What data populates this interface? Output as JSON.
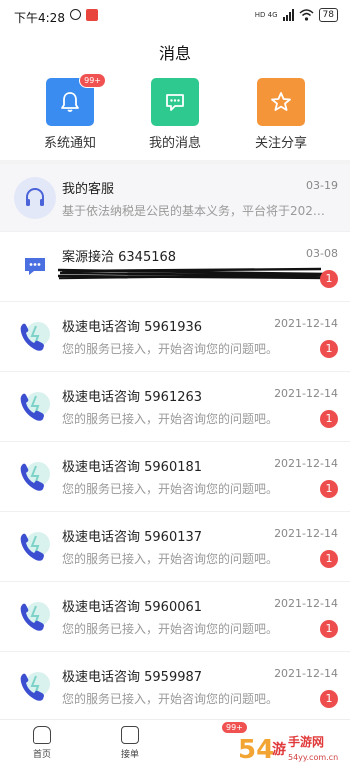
{
  "status_bar": {
    "time": "下午4:28",
    "network": "HD 4G",
    "battery": "78"
  },
  "header": {
    "title": "消息"
  },
  "shortcuts": [
    {
      "label": "系统通知",
      "badge": "99+",
      "color": "#3b8cf0",
      "icon": "bell-icon"
    },
    {
      "label": "我的消息",
      "color": "#2ec98e",
      "icon": "chat-bubble-icon"
    },
    {
      "label": "关注分享",
      "color": "#f5953a",
      "icon": "star-icon"
    }
  ],
  "messages": [
    {
      "title": "我的客服",
      "date": "03-19",
      "preview": "基于依法纳税是公民的基本义务，平台将于202…",
      "icon": "headset-icon"
    },
    {
      "title": "案源接洽  6345168",
      "date": "03-08",
      "preview": "(redacted)",
      "unread": "1",
      "icon": "message-bubble-icon"
    },
    {
      "title": "极速电话咨询  5961936",
      "date": "2021-12-14",
      "preview": "您的服务已接入，开始咨询您的问题吧。",
      "unread": "1",
      "icon": "phone-icon"
    },
    {
      "title": "极速电话咨询  5961263",
      "date": "2021-12-14",
      "preview": "您的服务已接入，开始咨询您的问题吧。",
      "unread": "1",
      "icon": "phone-icon"
    },
    {
      "title": "极速电话咨询  5960181",
      "date": "2021-12-14",
      "preview": "您的服务已接入，开始咨询您的问题吧。",
      "unread": "1",
      "icon": "phone-icon"
    },
    {
      "title": "极速电话咨询  5960137",
      "date": "2021-12-14",
      "preview": "您的服务已接入，开始咨询您的问题吧。",
      "unread": "1",
      "icon": "phone-icon"
    },
    {
      "title": "极速电话咨询  5960061",
      "date": "2021-12-14",
      "preview": "您的服务已接入，开始咨询您的问题吧。",
      "unread": "1",
      "icon": "phone-icon"
    },
    {
      "title": "极速电话咨询  5959987",
      "date": "2021-12-14",
      "preview": "您的服务已接入，开始咨询您的问题吧。",
      "unread": "1",
      "icon": "phone-icon"
    }
  ],
  "tabbar": {
    "home": "首页",
    "orders": "接单",
    "badge": "99+"
  },
  "watermark": {
    "text": "54游手游网",
    "sub": "54yy.com.cn"
  }
}
